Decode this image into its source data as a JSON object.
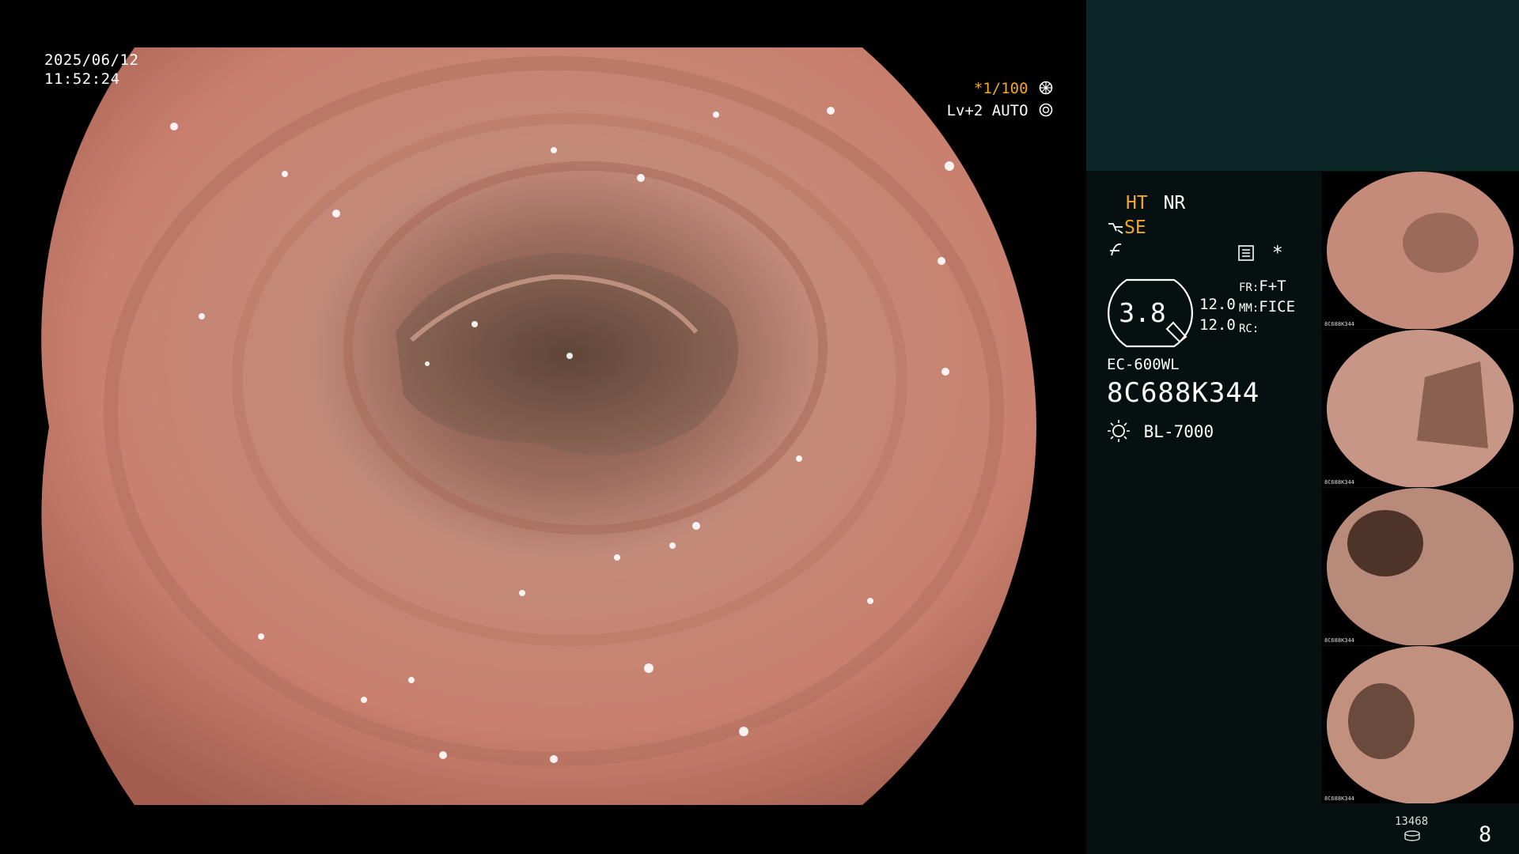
{
  "overlay": {
    "date": "2025/06/12",
    "time": "11:52:24",
    "shutter_speed": "*1/100",
    "iris_level": "Lv+2 AUTO"
  },
  "status": {
    "ht": "HT",
    "nr": "NR",
    "se": "SE",
    "gauge_value": "3.8",
    "val1": "12.0",
    "val2": "12.0",
    "fr_label": "FR:",
    "fr_value": "F+T",
    "mm_label": "MM:",
    "mm_value": "FICE",
    "rc_label": "RC:",
    "asterisk": "*",
    "scope_model": "EC-600WL",
    "scope_serial": "8C688K344",
    "light_source": "BL-7000"
  },
  "thumbnails": [
    {
      "caption": "8C688K344",
      "tone": "#c48a7a"
    },
    {
      "caption": "8C688K344",
      "tone": "#c79686"
    },
    {
      "caption": "8C688K344",
      "tone": "#b88a7a"
    },
    {
      "caption": "8C688K344",
      "tone": "#c2907e"
    }
  ],
  "footer": {
    "image_count": "13468",
    "page_number": "8"
  },
  "colors": {
    "accent": "#f5a623",
    "panel_bg": "#071010",
    "panel_top": "#0a2626",
    "tissue": "#c88474"
  }
}
